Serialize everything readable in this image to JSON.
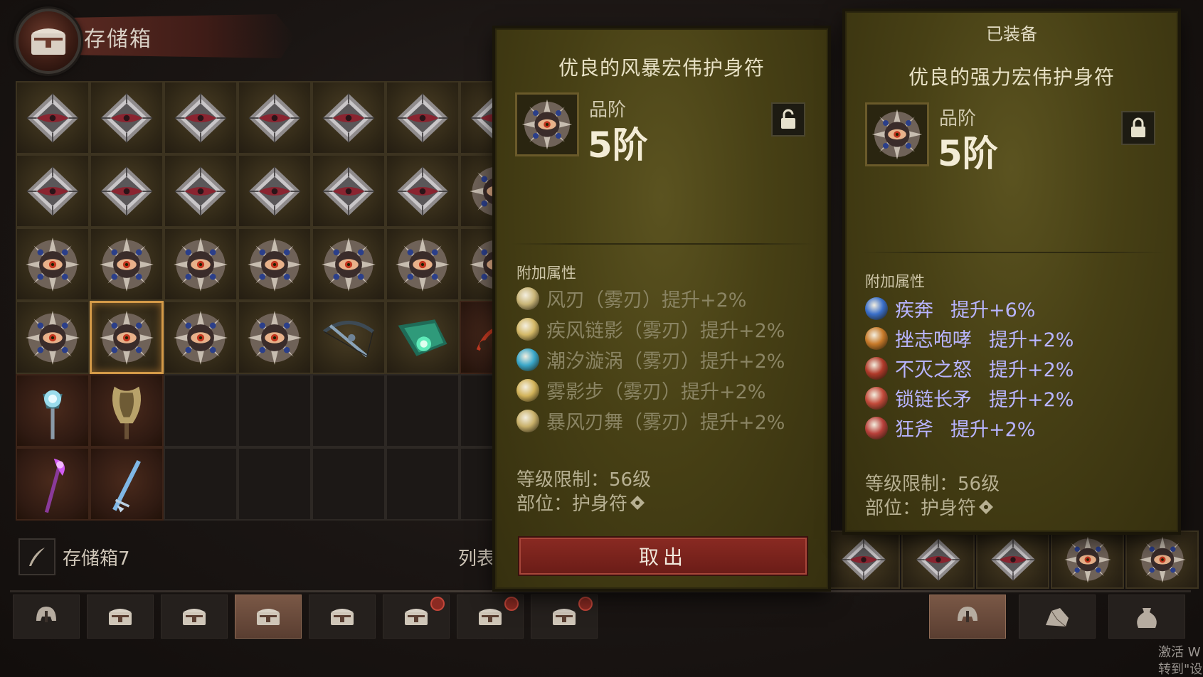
{
  "stash": {
    "title": "存储箱",
    "name": "存储箱7",
    "list_label": "列表"
  },
  "grid": {
    "rows": [
      [
        "gem-diamond",
        "gem-diamond",
        "gem-diamond",
        "gem-diamond",
        "gem-diamond",
        "gem-diamond",
        "gem-diamond"
      ],
      [
        "gem-diamond",
        "gem-diamond",
        "gem-diamond",
        "gem-diamond",
        "gem-diamond",
        "gem-diamond",
        "amulet"
      ],
      [
        "amulet",
        "amulet",
        "amulet",
        "amulet",
        "amulet",
        "amulet",
        "amulet"
      ],
      [
        "amulet",
        "amulet-selected",
        "amulet",
        "amulet",
        "crossbow",
        "jade-blade",
        "legend"
      ],
      [
        "scepter",
        "axe",
        "empty",
        "empty",
        "empty",
        "empty",
        "empty"
      ],
      [
        "staff",
        "dagger",
        "empty",
        "empty",
        "empty",
        "empty",
        "empty"
      ]
    ]
  },
  "tooltip_item": {
    "name": "优良的风暴宏伟护身符",
    "tier_label": "品阶",
    "tier_value": "5阶",
    "attr_title": "附加属性",
    "affixes": [
      {
        "text": "风刃（雾刃）提升+2%",
        "icon_color": "#c9b577"
      },
      {
        "text": "疾风链影（雾刃）提升+2%",
        "icon_color": "#d3b867"
      },
      {
        "text": "潮汐漩涡（雾刃）提升+2%",
        "icon_color": "#3aa7c9"
      },
      {
        "text": "雾影步（雾刃）提升+2%",
        "icon_color": "#d2b35a"
      },
      {
        "text": "暴风刃舞（雾刃）提升+2%",
        "icon_color": "#c8b06a"
      }
    ],
    "level_req": "等级限制：56级",
    "slot": "部位：护身符",
    "takeout_label": "取出"
  },
  "equipped_item": {
    "header": "已装备",
    "name": "优良的强力宏伟护身符",
    "tier_label": "品阶",
    "tier_value": "5阶",
    "attr_title": "附加属性",
    "affixes": [
      {
        "name": "疾奔",
        "bonus": "提升+6%",
        "icon_color": "#3a6fc9"
      },
      {
        "name": "挫志咆哮",
        "bonus": "提升+2%",
        "icon_color": "#c77a2a"
      },
      {
        "name": "不灭之怒",
        "bonus": "提升+2%",
        "icon_color": "#b03a2a"
      },
      {
        "name": "锁链长矛",
        "bonus": "提升+2%",
        "icon_color": "#c24a3a"
      },
      {
        "name": "狂斧",
        "bonus": "提升+2%",
        "icon_color": "#b8403a"
      }
    ],
    "level_req": "等级限制：56级",
    "slot": "部位：护身符"
  },
  "bottom_tabs": [
    "helmet-icon",
    "chest-icon",
    "chest-icon",
    "chest-icon",
    "chest-icon",
    "chest-locked-icon",
    "chest-locked-icon",
    "chest-locked-icon"
  ],
  "right_tabs": [
    "helmet-icon",
    "rock-icon",
    "bag-icon"
  ],
  "watermark": {
    "line1": "激活 W",
    "line2": "转到\"设置"
  },
  "colors": {
    "panel": "#474015",
    "affix_blue": "#b8b4ff",
    "takeout": "#7a241d",
    "selected_border": "#d49a48"
  }
}
